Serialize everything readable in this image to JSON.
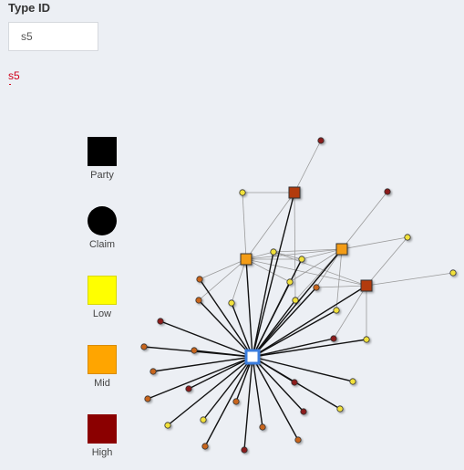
{
  "form": {
    "label": "Type ID",
    "input_value": "s5",
    "result_text": "s5"
  },
  "legend": [
    {
      "label": "Party",
      "shape": "square",
      "color": "#000000"
    },
    {
      "label": "Claim",
      "shape": "circle",
      "color": "#000000"
    },
    {
      "label": "Low",
      "shape": "square",
      "color": "#ffff00"
    },
    {
      "label": "Mid",
      "shape": "square",
      "color": "#ffa500"
    },
    {
      "label": "High",
      "shape": "square",
      "color": "#8b0000"
    }
  ],
  "colors": {
    "low": "#f2e13a",
    "mid": "#f39c12",
    "high_claim": "#8b1a1a",
    "orange_claim": "#c8651b",
    "high_party": "#b23a0f",
    "focus_fill": "#ffffff",
    "focus_stroke": "#3b7ddd",
    "link_strong": "#111111",
    "link_weak": "#9a9a9a"
  }
}
